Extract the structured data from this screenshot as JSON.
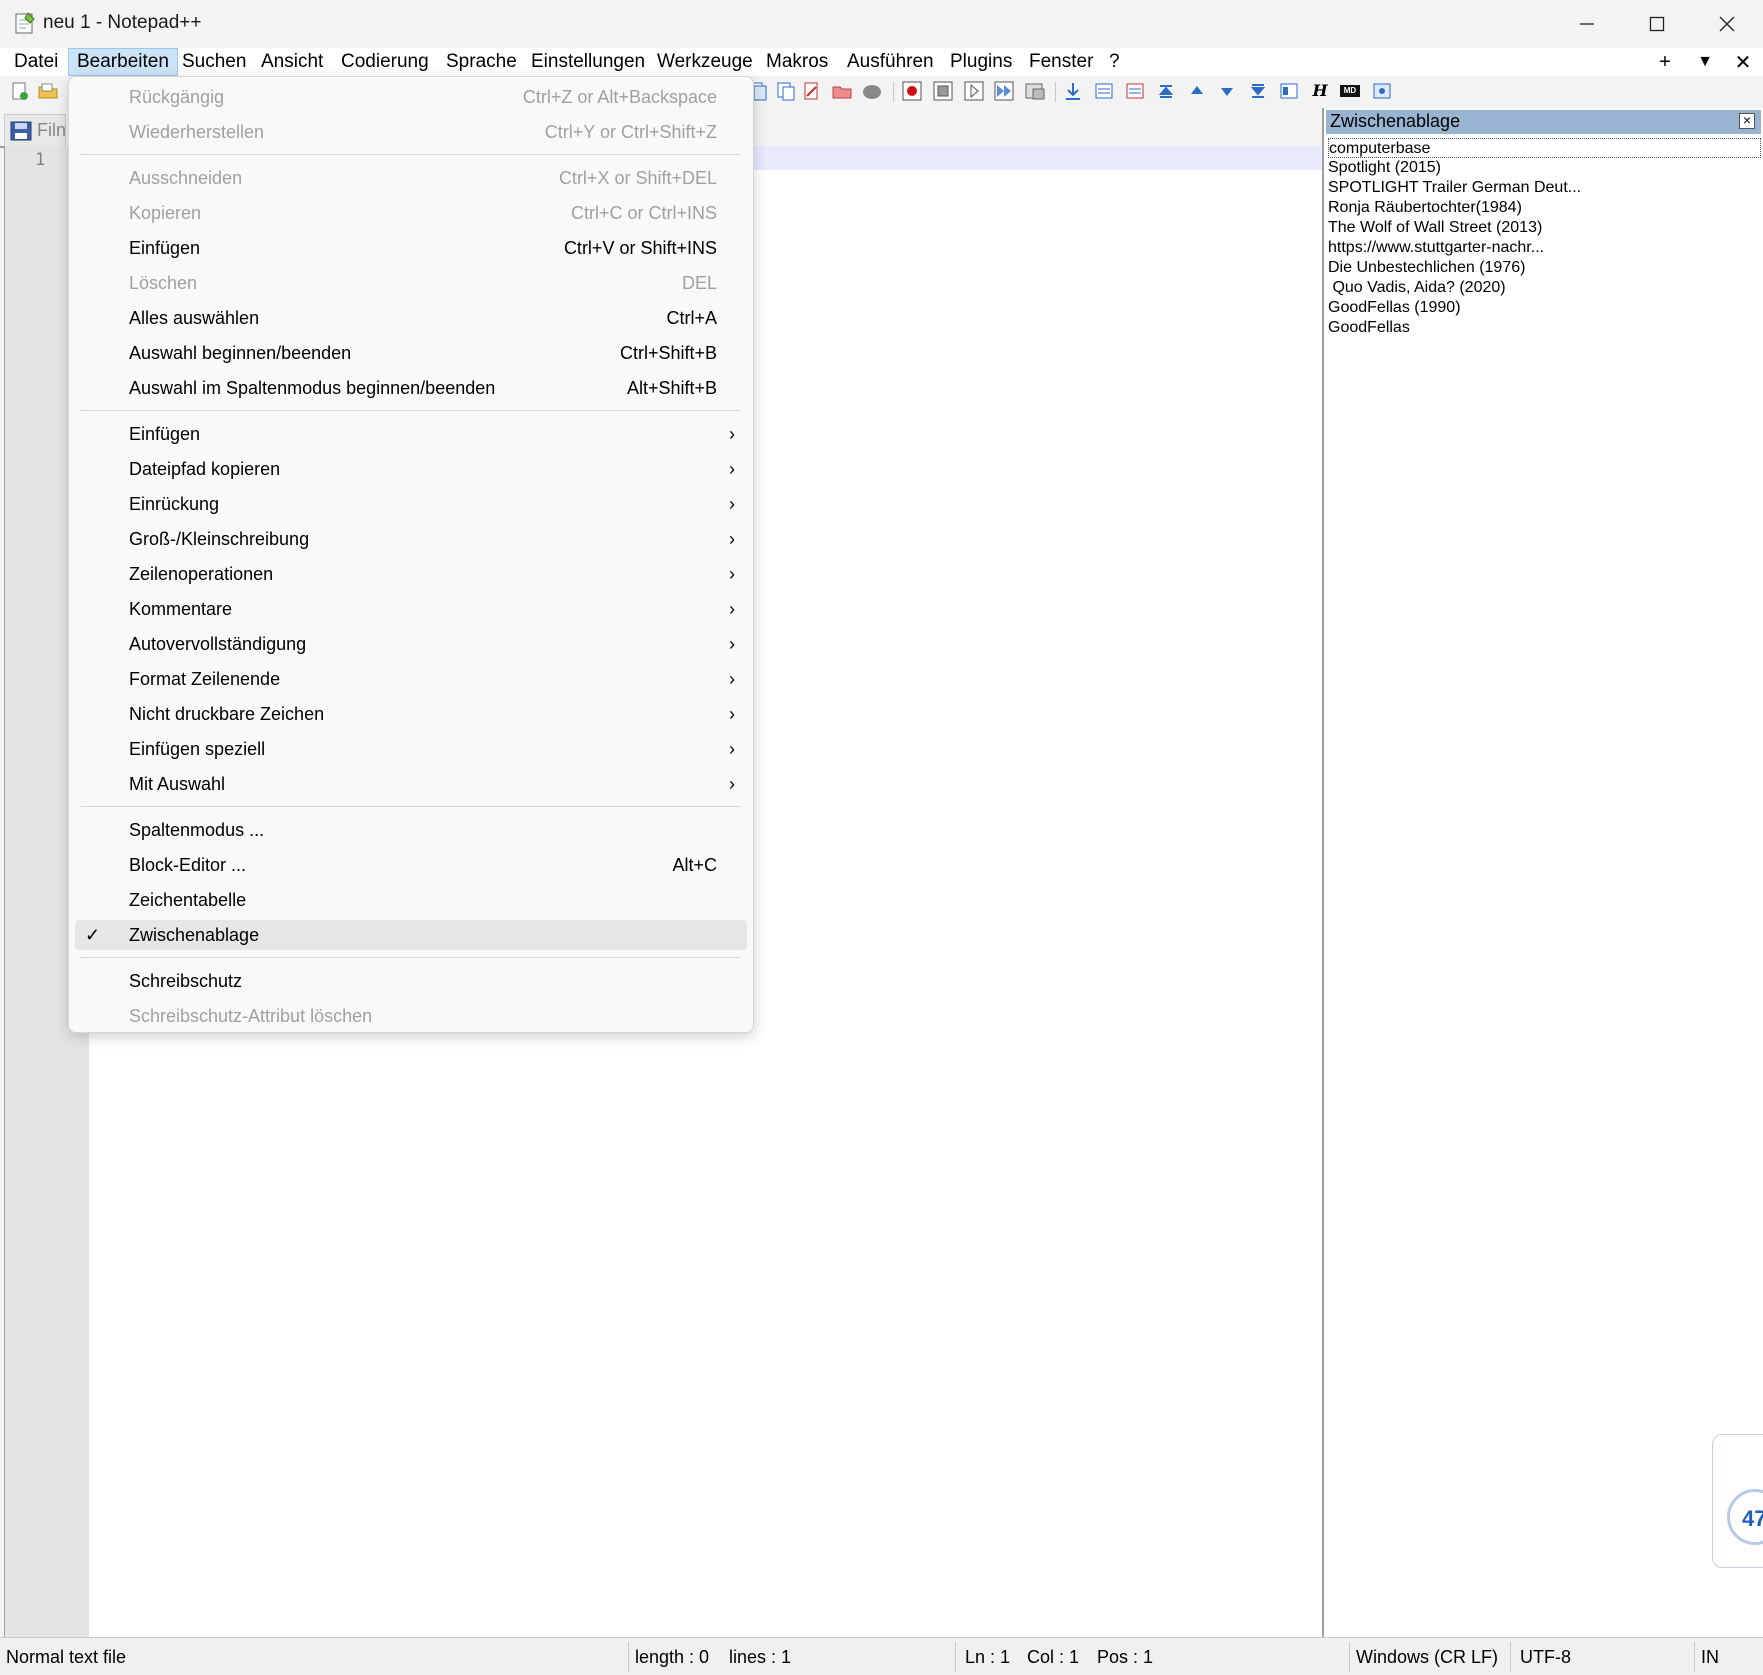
{
  "window": {
    "title": "neu 1 - Notepad++",
    "minimize_icon": "minimize-icon",
    "maximize_icon": "maximize-icon",
    "close_icon": "close-icon"
  },
  "menubar": {
    "items": [
      "Datei",
      "Bearbeiten",
      "Suchen",
      "Ansicht",
      "Codierung",
      "Sprache",
      "Einstellungen",
      "Werkzeuge",
      "Makros",
      "Ausführen",
      "Plugins",
      "Fenster",
      "?"
    ],
    "open_item": "Bearbeiten",
    "right_plus": "+",
    "right_dropdown": "▼",
    "right_close": "✕"
  },
  "tab": {
    "label": "Filn"
  },
  "editor": {
    "line_number": "1"
  },
  "edit_menu": {
    "items": [
      {
        "label": "Rückgängig",
        "shortcut": "Ctrl+Z or Alt+Backspace",
        "disabled": true
      },
      {
        "label": "Wiederherstellen",
        "shortcut": "Ctrl+Y or Ctrl+Shift+Z",
        "disabled": true
      },
      {
        "label": "Ausschneiden",
        "shortcut": "Ctrl+X or Shift+DEL",
        "disabled": true
      },
      {
        "label": "Kopieren",
        "shortcut": "Ctrl+C or Ctrl+INS",
        "disabled": true
      },
      {
        "label": "Einfügen",
        "shortcut": "Ctrl+V or Shift+INS",
        "disabled": false
      },
      {
        "label": "Löschen",
        "shortcut": "DEL",
        "disabled": true
      },
      {
        "label": "Alles auswählen",
        "shortcut": "Ctrl+A",
        "disabled": false
      },
      {
        "label": "Auswahl beginnen/beenden",
        "shortcut": "Ctrl+Shift+B",
        "disabled": false
      },
      {
        "label": "Auswahl im Spaltenmodus beginnen/beenden",
        "shortcut": "Alt+Shift+B",
        "disabled": false
      },
      {
        "label": "Einfügen",
        "submenu": true
      },
      {
        "label": "Dateipfad kopieren",
        "submenu": true
      },
      {
        "label": "Einrückung",
        "submenu": true
      },
      {
        "label": "Groß-/Kleinschreibung",
        "submenu": true
      },
      {
        "label": "Zeilenoperationen",
        "submenu": true
      },
      {
        "label": "Kommentare",
        "submenu": true
      },
      {
        "label": "Autovervollständigung",
        "submenu": true
      },
      {
        "label": "Format Zeilenende",
        "submenu": true
      },
      {
        "label": "Nicht druckbare Zeichen",
        "submenu": true
      },
      {
        "label": "Einfügen speziell",
        "submenu": true
      },
      {
        "label": "Mit Auswahl",
        "submenu": true
      },
      {
        "label": "Spaltenmodus ...",
        "shortcut": ""
      },
      {
        "label": "Block-Editor ...",
        "shortcut": "Alt+C"
      },
      {
        "label": "Zeichentabelle",
        "shortcut": ""
      },
      {
        "label": "Zwischenablage",
        "checked": true
      },
      {
        "label": "Schreibschutz",
        "shortcut": ""
      },
      {
        "label": "Schreibschutz-Attribut löschen",
        "disabled": true
      }
    ],
    "check_mark": "✓",
    "submenu_arrow": "›"
  },
  "clipboard_panel": {
    "title": "Zwischenablage",
    "close": "×",
    "entries": [
      "computerbase",
      "Spotlight (2015)",
      "SPOTLIGHT Trailer German Deut...",
      "Ronja Räubertochter(1984)",
      "The Wolf of Wall Street (2013)",
      "https://www.stuttgarter-nachr...",
      "Die Unbestechlichen (1976)",
      " Quo Vadis, Aida? (2020)",
      "GoodFellas (1990)",
      "GoodFellas"
    ]
  },
  "statusbar": {
    "file_type": "Normal text file",
    "length": "length : 0",
    "lines": "lines : 1",
    "ln": "Ln : 1",
    "col": "Col : 1",
    "pos": "Pos : 1",
    "eol": "Windows (CR LF)",
    "encoding": "UTF-8",
    "mode": "IN"
  },
  "side_widget": {
    "number": "47"
  },
  "colors": {
    "panel_header": "#99b4d1",
    "current_line": "#e8e8ff",
    "menu_open": "#cce4f7",
    "record_red": "#d01010"
  }
}
